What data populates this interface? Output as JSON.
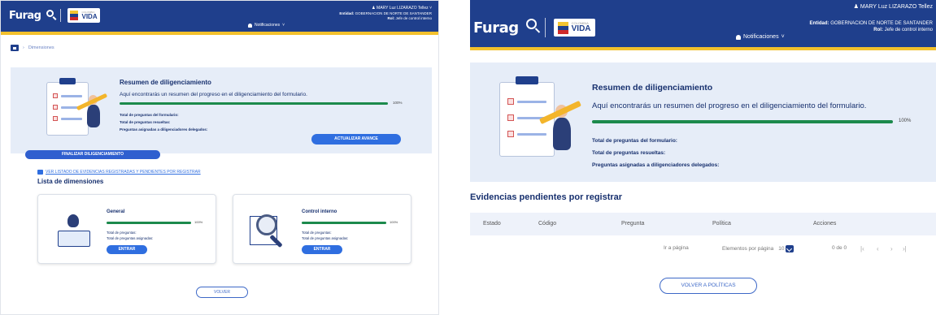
{
  "header": {
    "logo_text": "Furag",
    "logo_sub": "",
    "vida_small": "COLOMBIA",
    "vida_text": "VIDA",
    "user": "MARY Luz LIZARAZO Tellez",
    "entidad_label": "Entidad:",
    "entidad_value": "GOBERNACION DE NORTE DE SANTANDER",
    "rol_label": "Rol:",
    "rol_value": "Jefe de control interno",
    "notifications_label": "Notificaciones"
  },
  "left": {
    "breadcrumb": "Dimensiones",
    "summary": {
      "title": "Resumen de diligenciamiento",
      "description": "Aquí encontrarás un resumen del progreso en el diligenciamiento del formulario.",
      "progress": 100,
      "progress_label": "100%",
      "stat_total": "Total de preguntas del formulario:",
      "stat_resueltas": "Total de preguntas resueltas:",
      "stat_asignadas": "Preguntas asignadas a diligenciadores delegados:",
      "update_button": "ACTUALIZAR AVANCE"
    },
    "finalizar_button": "FINALIZAR DILIGENCIAMIENTO",
    "evidencias_link": "VER LISTADO DE EVIDENCIAS REGISTRADAS Y PENDIENTES POR REGISTRAR",
    "lista_title": "Lista de dimensiones",
    "dimensions": [
      {
        "name": "General",
        "progress": 100,
        "progress_label": "100%",
        "stat_a": "Total de preguntas:",
        "stat_b": "Total de preguntas asignadas:",
        "button": "ENTRAR"
      },
      {
        "name": "Control interno",
        "progress": 100,
        "progress_label": "100%",
        "stat_a": "Total de preguntas:",
        "stat_b": "Total de preguntas asignadas:",
        "button": "ENTRAR"
      }
    ],
    "volver_button": "VOLVER"
  },
  "right": {
    "summary": {
      "title": "Resumen de diligenciamiento",
      "description": "Aquí encontrarás un resumen del progreso en el diligenciamiento del formulario.",
      "progress": 100,
      "progress_label": "100%",
      "stat_total": "Total de preguntas del formulario:",
      "stat_resueltas": "Total de preguntas resueltas:",
      "stat_asignadas": "Preguntas asignadas a diligenciadores delegados:"
    },
    "evidencias_title": "Evidencias pendientes por registrar",
    "table_columns": [
      "Estado",
      "Código",
      "Pregunta",
      "Política",
      "Acciones"
    ],
    "pager": {
      "goto_label": "Ir a página",
      "per_page_label": "Elementos por página",
      "per_page_value": "10",
      "range": "0 de 0"
    },
    "volver_button": "VOLVER A POLÍTICAS"
  },
  "colors": {
    "header_bg": "#1f3f8c",
    "accent_yellow": "#f3c12c",
    "progress_green": "#1c8a4c",
    "button_blue": "#2f6ee0",
    "summary_bg": "#e6edf8"
  }
}
